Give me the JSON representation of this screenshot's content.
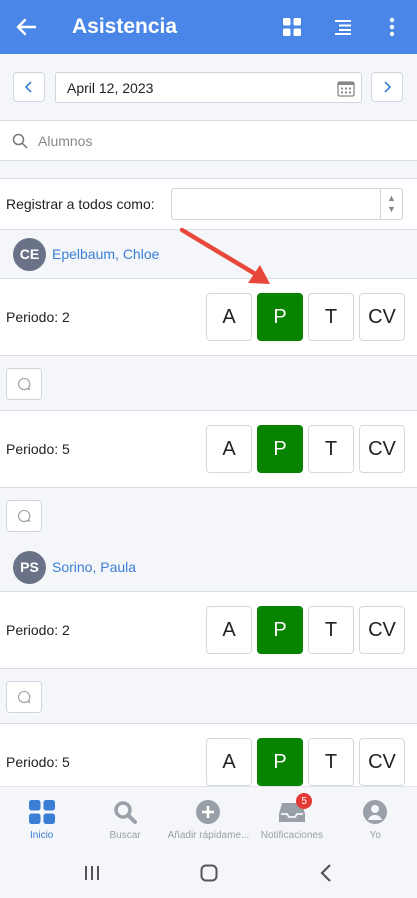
{
  "header": {
    "title": "Asistencia",
    "actions": [
      "grid-icon",
      "list-icon",
      "more-vertical-icon"
    ]
  },
  "date_nav": {
    "date": "April 12, 2023"
  },
  "search": {
    "placeholder": "Alumnos"
  },
  "register_all": {
    "label": "Registrar a todos como:",
    "value": ""
  },
  "students": [
    {
      "initials": "CE",
      "name": "Epelbaum, Chloe",
      "periods": [
        {
          "label": "Periodo: 2",
          "options": [
            "A",
            "P",
            "T",
            "CV"
          ],
          "selected": "P"
        },
        {
          "label": "Periodo: 5",
          "options": [
            "A",
            "P",
            "T",
            "CV"
          ],
          "selected": "P"
        }
      ]
    },
    {
      "initials": "PS",
      "name": "Sorino, Paula",
      "periods": [
        {
          "label": "Periodo: 2",
          "options": [
            "A",
            "P",
            "T",
            "CV"
          ],
          "selected": "P"
        },
        {
          "label": "Periodo: 5",
          "options": [
            "A",
            "P",
            "T",
            "CV"
          ],
          "selected": "P"
        }
      ]
    }
  ],
  "tabbar": {
    "items": [
      {
        "label": "Inicio",
        "icon": "home-grid-icon",
        "active": true
      },
      {
        "label": "Buscar",
        "icon": "search-icon"
      },
      {
        "label": "Añadir rápidame...",
        "icon": "add-circle-icon"
      },
      {
        "label": "Notificaciones",
        "icon": "inbox-icon",
        "badge": "5"
      },
      {
        "label": "Yo",
        "icon": "person-icon"
      }
    ]
  },
  "colors": {
    "primary": "#4a86e8",
    "present": "#078300",
    "link": "#3b7fd4",
    "annotation_arrow": "#e8483c"
  }
}
